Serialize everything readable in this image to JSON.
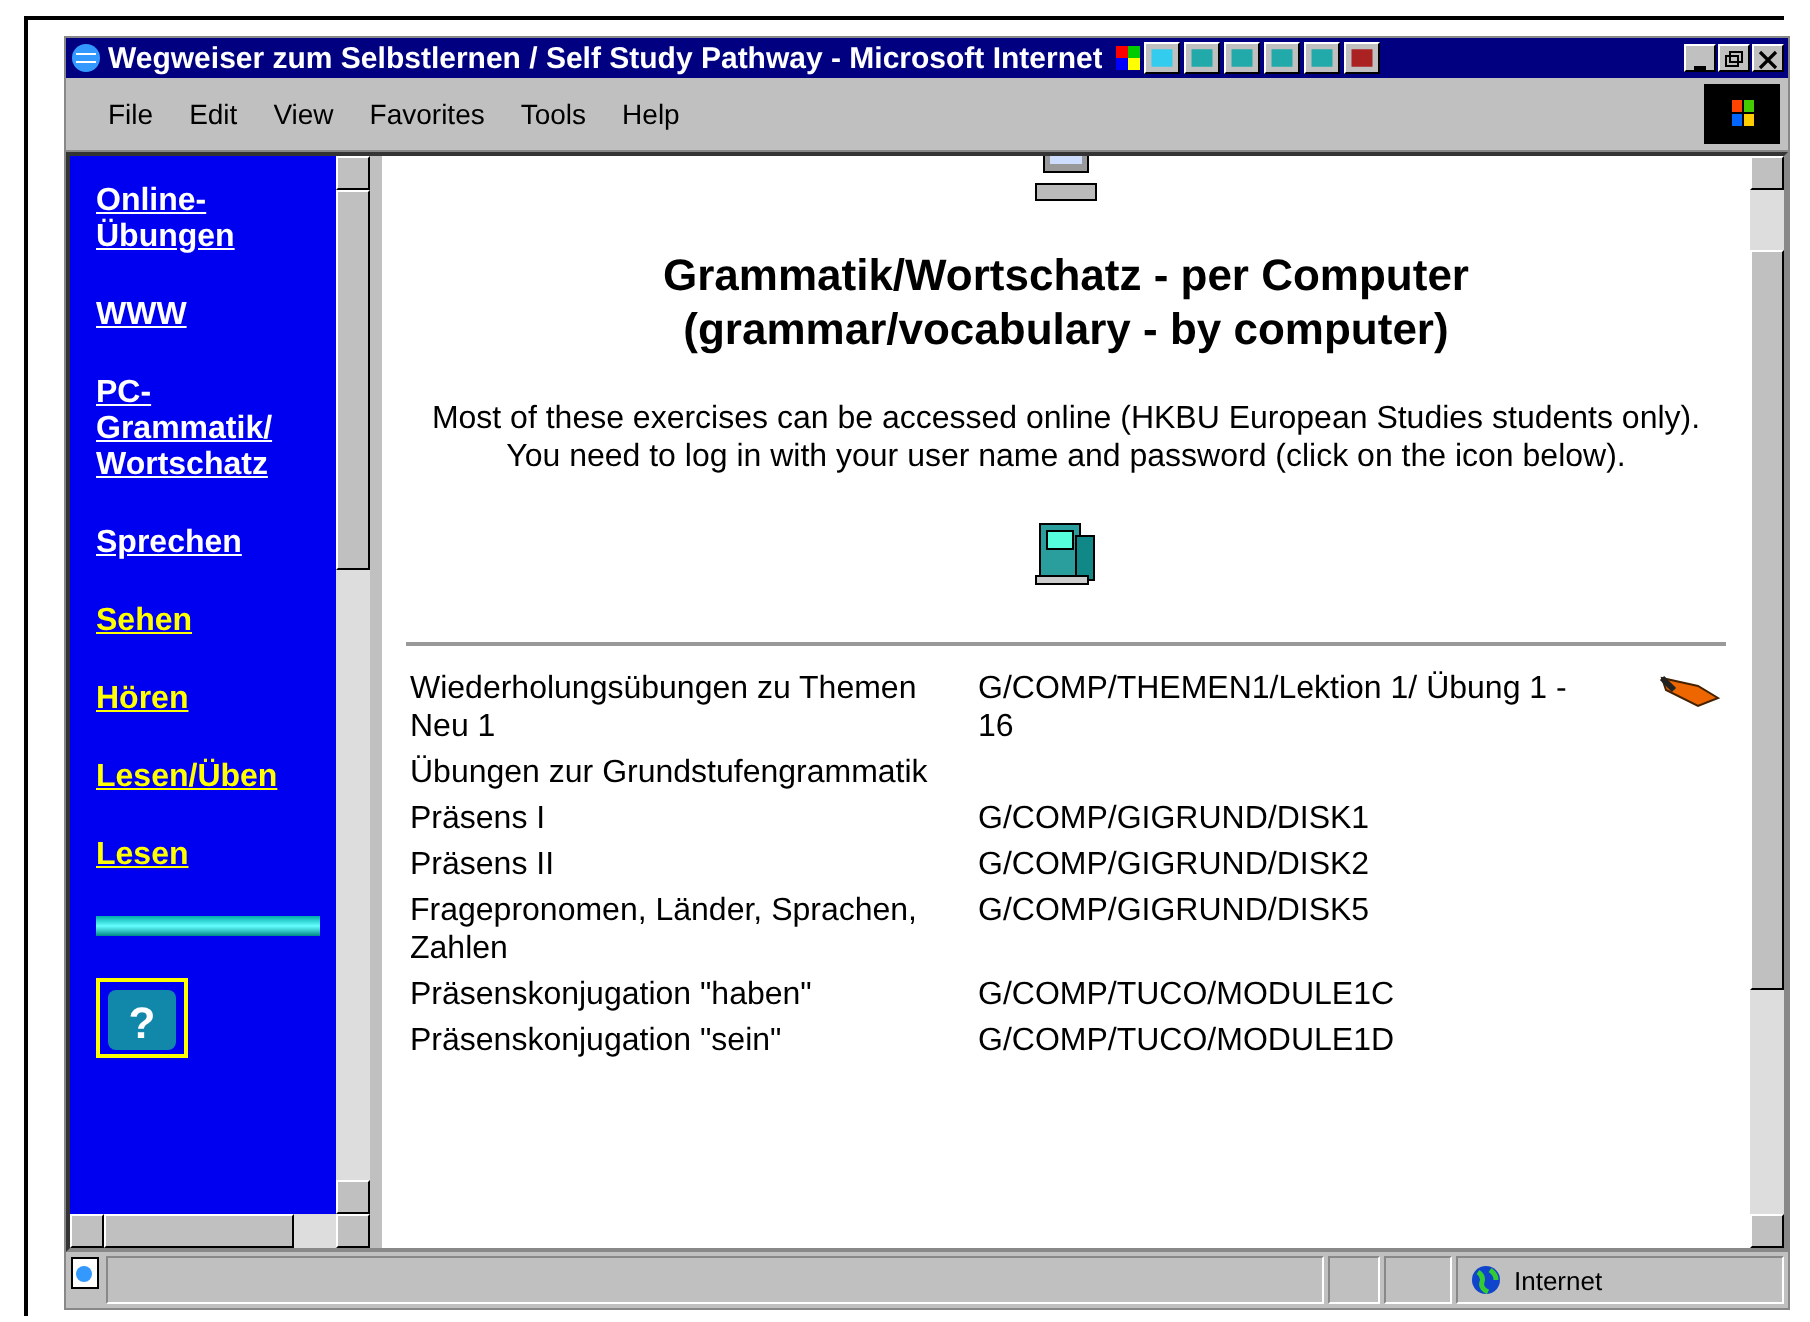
{
  "window": {
    "title": "Wegweiser zum Selbstlernen / Self Study Pathway - Microsoft Internet"
  },
  "menu": [
    "File",
    "Edit",
    "View",
    "Favorites",
    "Tools",
    "Help"
  ],
  "sidebar": {
    "items": [
      {
        "label": "Online-\nÜbungen",
        "visited": false
      },
      {
        "label": "WWW",
        "visited": false
      },
      {
        "label": "PC-\nGrammatik/\nWortschatz",
        "visited": false
      },
      {
        "label": "Sprechen",
        "visited": false
      },
      {
        "label": "Sehen",
        "visited": true
      },
      {
        "label": "Hören",
        "visited": true
      },
      {
        "label": "Lesen/Üben",
        "visited": true
      },
      {
        "label": "Lesen",
        "visited": true
      }
    ],
    "help_icon": "?"
  },
  "content": {
    "heading": [
      "Grammatik/Wortschatz - per Computer",
      "(grammar/vocabulary - by computer)"
    ],
    "intro": [
      "Most of these exercises can be accessed online (HKBU European Studies students only).",
      "You need to log in with your user name and password (click on the icon below)."
    ],
    "rows": [
      {
        "topic": "Wiederholungsübungen zu Themen Neu 1",
        "location": "G/COMP/THEMEN1/Lektion 1/ Übung 1 - 16",
        "kind": "link"
      },
      {
        "topic": "Übungen zur Grundstufengrammatik",
        "kind": "plain"
      },
      {
        "topic": "Präsens I",
        "location": "G/COMP/GIGRUND/DISK1",
        "kind": "plain"
      },
      {
        "topic": "Präsens II",
        "location": "G/COMP/GIGRUND/DISK2",
        "kind": "plain"
      },
      {
        "topic": "Fragepronomen, Länder, Sprachen, Zahlen",
        "location": "G/COMP/GIGRUND/DISK5",
        "kind": "plain"
      },
      {
        "topic": "Präsenskonjugation \"haben\"",
        "location": "G/COMP/TUCO/MODULE1C",
        "kind": "plain"
      },
      {
        "topic": "Präsenskonjugation \"sein\"",
        "location": "G/COMP/TUCO/MODULE1D",
        "kind": "plain"
      }
    ]
  },
  "status_bar": {
    "zone": "Internet"
  }
}
